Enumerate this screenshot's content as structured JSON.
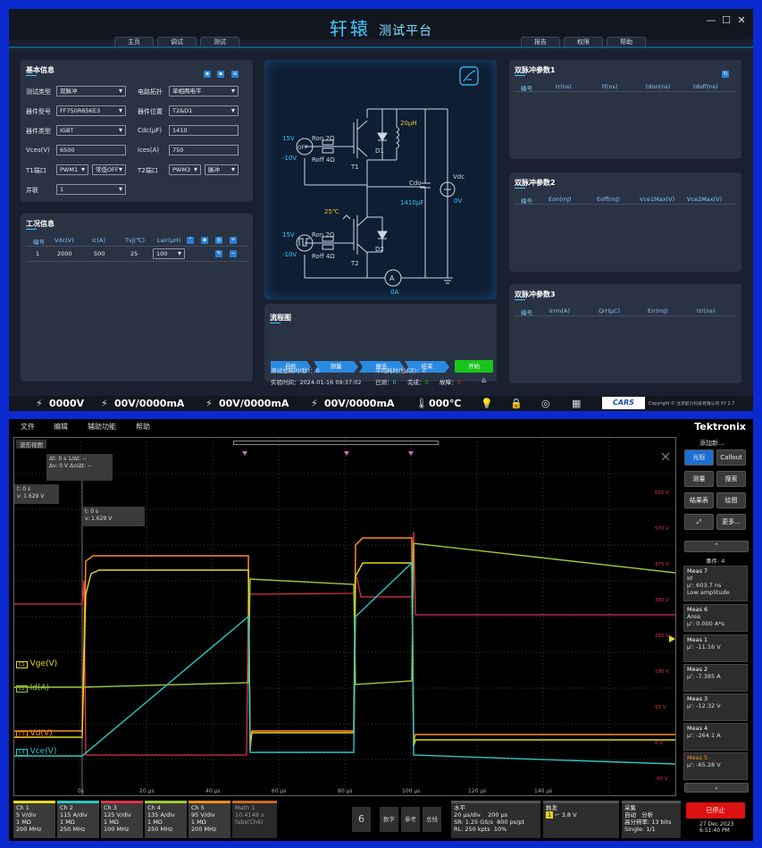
{
  "app1": {
    "title_main": "轩辕",
    "title_sub": "测试平台",
    "tabs_left": [
      "主页",
      "调试",
      "测试"
    ],
    "tabs_right": [
      "报告",
      "权限",
      "帮助"
    ],
    "win": {
      "min": "—",
      "max": "☐",
      "close": "✕"
    },
    "basic": {
      "title": "基本信息",
      "test_type_label": "测试类型",
      "test_type": "双脉冲",
      "topology_label": "电路拓扑",
      "topology": "单相两电平",
      "device_model_label": "器件型号",
      "device_model": "FF750R65KE3",
      "device_pos_label": "器件位置",
      "device_pos": "T2&D1",
      "device_type_label": "器件类型",
      "device_type": "IGBT",
      "cdc_label": "Cdc(μF)",
      "cdc": "1410",
      "vces_label": "Vces(V)",
      "vces": "6500",
      "ices_label": "Ices(A)",
      "ices": "750",
      "t1_label": "T1端口",
      "t1_port": "PWM1",
      "t1_mode": "常低OFF",
      "t2_label": "T2端口",
      "t2_port": "PWM3",
      "t2_mode": "脉冲",
      "parallel_label": "并联",
      "parallel": "1"
    },
    "condition": {
      "title": "工况信息",
      "headers": [
        "编号",
        "Vdc(V)",
        "Ic(A)",
        "Tvj(℃)",
        "Lair(μH)"
      ],
      "row": [
        "1",
        "2000",
        "500",
        "25",
        "100"
      ]
    },
    "circuit": {
      "v15a": "15V",
      "off": "OFF",
      "vneg10a": "-10V",
      "ron_a": "Ron 2Ω",
      "roff_a": "Roff 4Ω",
      "t1": "T1",
      "d1": "D1",
      "l": "20μH",
      "cdc": "Cdc",
      "cap": "1410μF",
      "vdc": "Vdc",
      "v0": "0V",
      "temp": "25℃",
      "v15b": "15V",
      "vneg10b": "-10V",
      "ron_b": "Ron 2Ω",
      "roff_b": "Roff 4Ω",
      "t2": "T2",
      "d2": "D2",
      "amp": "A",
      "a0": "0A"
    },
    "flow": {
      "title": "流程图",
      "steps": [
        "自检",
        "测量",
        "报告",
        "结束"
      ],
      "start": "开始",
      "total_time_label": "测试总耗时(秒)：",
      "total_time": "0",
      "avg_time_label": "平均耗时(秒/次)：",
      "avg_time": "0",
      "exp_time_label": "实验时间：",
      "exp_time": "2024-01-16 09:37:02",
      "used_label": "已测：",
      "used": "0",
      "done_label": "完成：",
      "done": "0",
      "fail_label": "故障：",
      "fail": "0"
    },
    "dp1": {
      "title": "双脉冲参数1",
      "headers": [
        "编号",
        "tr(ns)",
        "tf(ns)",
        "tdon(ns)",
        "tdoff(ns)"
      ]
    },
    "dp2": {
      "title": "双脉冲参数2",
      "headers": [
        "编号",
        "Eon(mJ)",
        "Eoff(mJ)",
        "Vce1Max(V)",
        "Vce2Max(V)"
      ]
    },
    "dp3": {
      "title": "双脉冲参数3",
      "headers": [
        "编号",
        "Irrm(A)",
        "Qrr(μC)",
        "Err(mJ)",
        "trr(ns)"
      ]
    },
    "status": {
      "s1": "0000V",
      "s2": "00V/0000mA",
      "s3": "00V/0000mA",
      "s4": "00V/0000mA",
      "temp": "000℃",
      "logo": "CARS",
      "copyright": "Copyright © 北京航力科技有限公司 XY 2.7"
    }
  },
  "app2": {
    "menu": [
      "文件",
      "编辑",
      "辅助功能",
      "帮助"
    ],
    "brand": "Tektronix",
    "wave_tab": "波形视图",
    "cursor1": {
      "dt": "Δt: 0 s",
      "dv": "Δv: 0 V",
      "r1": "1/Δt: --",
      "r2": "Δv/Δt: --"
    },
    "cursor2": {
      "t": "t: 0 s",
      "v": "v: 1.629 V"
    },
    "cursor3": {
      "t": "t: 0 s",
      "v": "v: 1.629 V"
    },
    "ch_labels": [
      "Vge(V)",
      "Id(A)",
      "Vd(V)",
      "Vce(V)"
    ],
    "xticks": [
      "0s",
      "20 μs",
      "40 μs",
      "60 μs",
      "80 μs",
      "100 μs",
      "120 μs",
      "140 μs"
    ],
    "yticks": [
      "665 V",
      "570 V",
      "475 V",
      "380 V",
      "285 V",
      "190 V",
      "95 V",
      "0 V",
      "-95 V"
    ],
    "side": {
      "add": "添加新...",
      "cursor": "光标",
      "callout": "Callout",
      "measure": "测量",
      "search": "搜索",
      "result": "结果表",
      "plot": "绘图",
      "more": "更多...",
      "events": "事件: 4"
    },
    "meas": [
      {
        "t": "Meas 7",
        "a": "Id",
        "b": "μ': 603.7 ns",
        "c": "Low amplitude"
      },
      {
        "t": "Meas 6",
        "a": "Area",
        "b": "μ': 0.000 A*s",
        "c": ""
      },
      {
        "t": "Meas 1",
        "a": "μ': -11.16 V",
        "b": "",
        "c": ""
      },
      {
        "t": "Meas 2",
        "a": "μ': -7.385 A",
        "b": "",
        "c": ""
      },
      {
        "t": "Meas 3",
        "a": "μ': -12.32 V",
        "b": "",
        "c": ""
      },
      {
        "t": "Meas 4",
        "a": "μ': -264.1 A",
        "b": "",
        "c": ""
      },
      {
        "t": "Meas 5",
        "a": "μ': -65.28 V",
        "b": "",
        "c": ""
      }
    ],
    "stop": "已停止",
    "date": "27 Dec 2023",
    "time": "6:51:40 PM",
    "ch": [
      {
        "n": "Ch 1",
        "a": "5 V/div",
        "b": "1 MΩ",
        "c": "200 MHz"
      },
      {
        "n": "Ch 2",
        "a": "115 A/div",
        "b": "1 MΩ",
        "c": "250 MHz"
      },
      {
        "n": "Ch 3",
        "a": "125 V/div",
        "b": "1 MΩ",
        "c": "100 MHz"
      },
      {
        "n": "Ch 4",
        "a": "135 A/div",
        "b": "1 MΩ",
        "c": "250 MHz"
      },
      {
        "n": "Ch 5",
        "a": "95 V/div",
        "b": "1 MΩ",
        "c": "200 MHz"
      },
      {
        "n": "Math 1",
        "a": "10.4148 x",
        "b": "fabs(Ch6)",
        "c": ""
      }
    ],
    "bottom": {
      "num": "6",
      "digital": "数字",
      "ref": "参考",
      "bus": "总线"
    },
    "h": {
      "title": "水平",
      "a": "20 μs/div",
      "a2": "200 μs",
      "b": "SR: 1.25 GS/s",
      "b2": "800 ps/pt",
      "c": "RL: 250 kpts",
      "c2": "10%"
    },
    "trig": {
      "title": "触发",
      "v": "3.8 V"
    },
    "acq": {
      "title": "采集",
      "a": "自动",
      "a2": "分析",
      "b": "高分辨率: 13 bits",
      "c": "Single: 1/1"
    }
  },
  "colors": {
    "cyan": "#3ec8ff",
    "green": "#19c41c",
    "blue": "#2a8ae0"
  }
}
